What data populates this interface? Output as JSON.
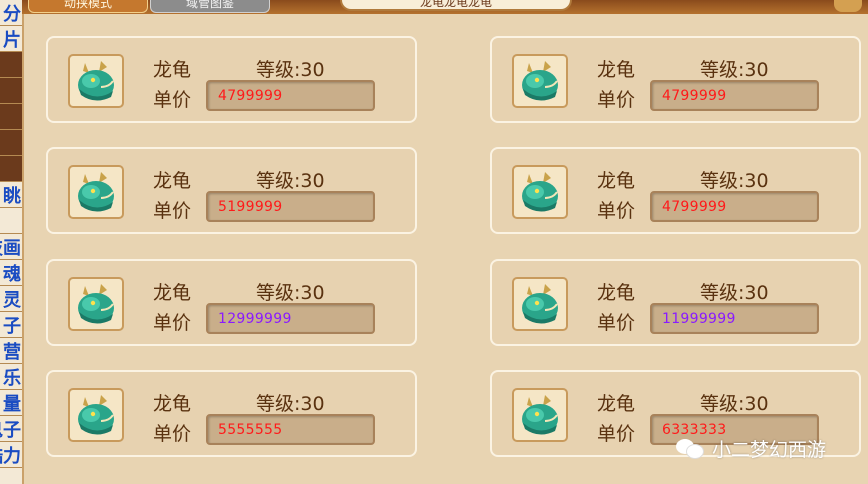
{
  "left_strip": [
    "分",
    "片",
    "",
    "",
    "",
    "",
    "",
    "眺",
    "",
    "技画",
    "魂",
    "灵",
    "子",
    "营",
    "乐",
    "量",
    "鬼子",
    "酷力"
  ],
  "tabs": {
    "active_label": "动挟模式",
    "inactive_label": "域管图鉴"
  },
  "panel_title": "龙龟龙龟龙龟",
  "price_label": "单价",
  "listings": [
    {
      "name": "龙龟",
      "level": "等级:30",
      "price": "4799999",
      "price_color": "#ff1a1a"
    },
    {
      "name": "龙龟",
      "level": "等级:30",
      "price": "4799999",
      "price_color": "#ff1a1a"
    },
    {
      "name": "龙龟",
      "level": "等级:30",
      "price": "5199999",
      "price_color": "#ff1a1a"
    },
    {
      "name": "龙龟",
      "level": "等级:30",
      "price": "4799999",
      "price_color": "#ff1a1a"
    },
    {
      "name": "龙龟",
      "level": "等级:30",
      "price": "12999999",
      "price_color": "#8a1aff"
    },
    {
      "name": "龙龟",
      "level": "等级:30",
      "price": "11999999",
      "price_color": "#8a1aff"
    },
    {
      "name": "龙龟",
      "level": "等级:30",
      "price": "5555555",
      "price_color": "#ff1a1a"
    },
    {
      "name": "龙龟",
      "level": "等级:30",
      "price": "6333333",
      "price_color": "#ff1a1a"
    }
  ],
  "watermark": "小二梦幻西游",
  "colors": {
    "panel_bg": "#e8d4b2",
    "text_brown": "#5a3210",
    "price_red": "#ff1a1a",
    "price_purple": "#8a1aff"
  }
}
